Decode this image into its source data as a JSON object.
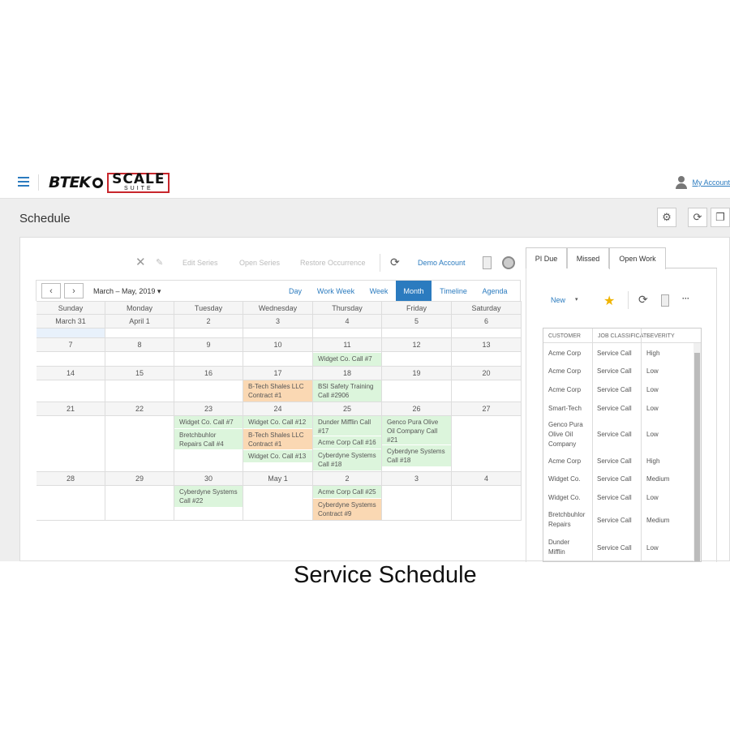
{
  "header": {
    "logo_left": "BTEK",
    "logo_scale": "SCALE",
    "logo_suite": "SUITE",
    "account_label": "My Account"
  },
  "page": {
    "title": "Schedule"
  },
  "toolbar": {
    "edit_series": "Edit Series",
    "open_series": "Open Series",
    "restore_occurrence": "Restore Occurrence",
    "demo_account": "Demo Account"
  },
  "calendar": {
    "range_label": "March – May, 2019",
    "views": [
      "Day",
      "Work Week",
      "Week",
      "Month",
      "Timeline",
      "Agenda"
    ],
    "active_view": "Month",
    "weekdays": [
      "Sunday",
      "Monday",
      "Tuesday",
      "Wednesday",
      "Thursday",
      "Friday",
      "Saturday"
    ],
    "weeks": [
      [
        "March 31",
        "April 1",
        "2",
        "3",
        "4",
        "5",
        "6"
      ],
      [
        "7",
        "8",
        "9",
        "10",
        "11",
        "12",
        "13"
      ],
      [
        "14",
        "15",
        "16",
        "17",
        "18",
        "19",
        "20"
      ],
      [
        "21",
        "22",
        "23",
        "24",
        "25",
        "26",
        "27"
      ],
      [
        "28",
        "29",
        "30",
        "May 1",
        "2",
        "3",
        "4"
      ]
    ],
    "events": {
      "w1_thu": "Widget Co. Call #7",
      "w2_wed": "B-Tech Shales LLC Contract #1",
      "w2_thu": "BSI Safety Training Call #2906",
      "w3_tue_1": "Widget Co. Call #7",
      "w3_tue_2": "Bretchbuhlor Repairs Call #4",
      "w3_wed_1": "Widget Co. Call #12",
      "w3_wed_2": "B-Tech Shales LLC Contract #1",
      "w3_wed_3": "Widget Co. Call #13",
      "w3_thu_1": "Dunder Mifflin Call #17",
      "w3_thu_2": "Acme Corp Call #16",
      "w3_thu_3": "Cyberdyne Systems Call #18",
      "w3_fri_1": "Genco Pura Olive Oil Company Call #21",
      "w3_fri_2": "Cyberdyne Systems Call #18",
      "w4_tue": "Cyberdyne Systems Call #22",
      "w4_thu_1": "Acme Corp Call #25",
      "w4_thu_2": "Cyberdyne Systems Contract #9"
    }
  },
  "caption": "Service Schedule",
  "side": {
    "tabs": [
      "PI Due",
      "Missed",
      "Open Work"
    ],
    "active_tab": "Open Work",
    "new_label": "New",
    "more_label": "···",
    "columns": [
      "CUSTOMER",
      "JOB CLASSIFICATI",
      "SEVERITY"
    ],
    "rows": [
      [
        "Acme Corp",
        "Service Call",
        "High"
      ],
      [
        "Acme Corp",
        "Service Call",
        "Low"
      ],
      [
        "Acme Corp",
        "Service Call",
        "Low"
      ],
      [
        "Smart-Tech",
        "Service Call",
        "Low"
      ],
      [
        "Genco Pura Olive Oil Company",
        "Service Call",
        "Low"
      ],
      [
        "Acme Corp",
        "Service Call",
        "High"
      ],
      [
        "Widget Co.",
        "Service Call",
        "Medium"
      ],
      [
        "Widget Co.",
        "Service Call",
        "Low"
      ],
      [
        "Bretchbuhlor Repairs",
        "Service Call",
        "Medium"
      ],
      [
        "Dunder Mifflin",
        "Service Call",
        "Low"
      ]
    ]
  },
  "colors": {
    "accent": "#2b7bbf",
    "event_green": "#dcf5dc",
    "event_orange": "#fad8b3",
    "logo_red": "#c8262c"
  }
}
